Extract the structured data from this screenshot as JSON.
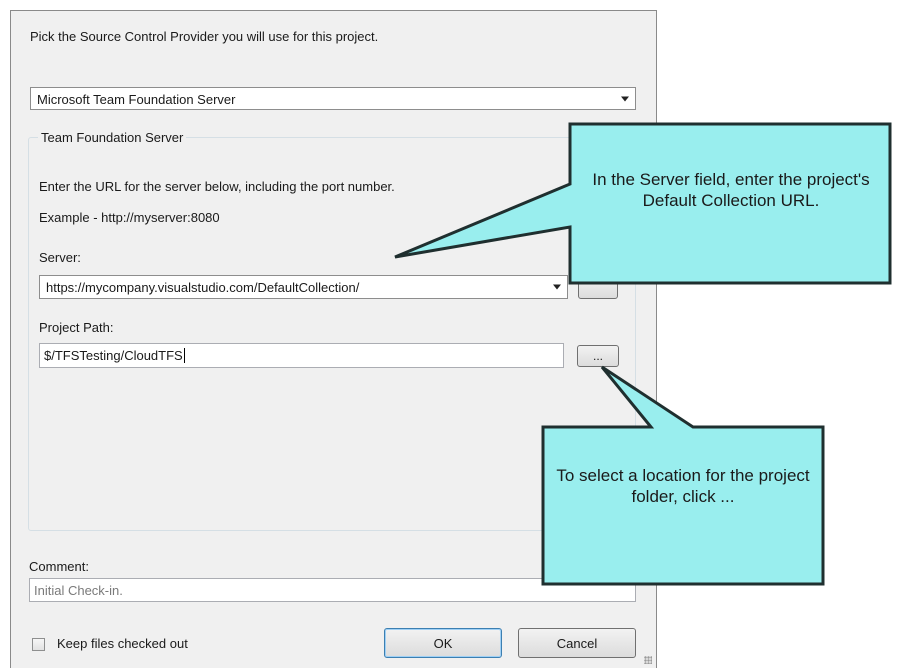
{
  "dialog": {
    "instruction": "Pick the Source Control Provider you will use for this project.",
    "provider_select": {
      "value": "Microsoft Team Foundation Server"
    },
    "tfs_group": {
      "legend": "Team Foundation Server",
      "url_hint": "Enter the URL for the server below, including the port number.",
      "example": "Example - http://myserver:8080",
      "server_label": "Server:",
      "server_value": "https://mycompany.visualstudio.com/DefaultCollection/",
      "project_path_label": "Project Path:",
      "project_path_value": "$/TFSTesting/CloudTFS",
      "browse_label": "..."
    },
    "comment_label": "Comment:",
    "comment_value": "Initial Check-in.",
    "keep_checked_out_label": "Keep files checked out",
    "ok_label": "OK",
    "cancel_label": "Cancel"
  },
  "callouts": {
    "server": "In the Server field, enter the project's Default Collection URL.",
    "browse": "To select a location for the project folder, click ..."
  },
  "colors": {
    "callout_fill": "#99eeee",
    "callout_border": "#1f2f2f",
    "dialog_bg": "#f0f0f0"
  }
}
